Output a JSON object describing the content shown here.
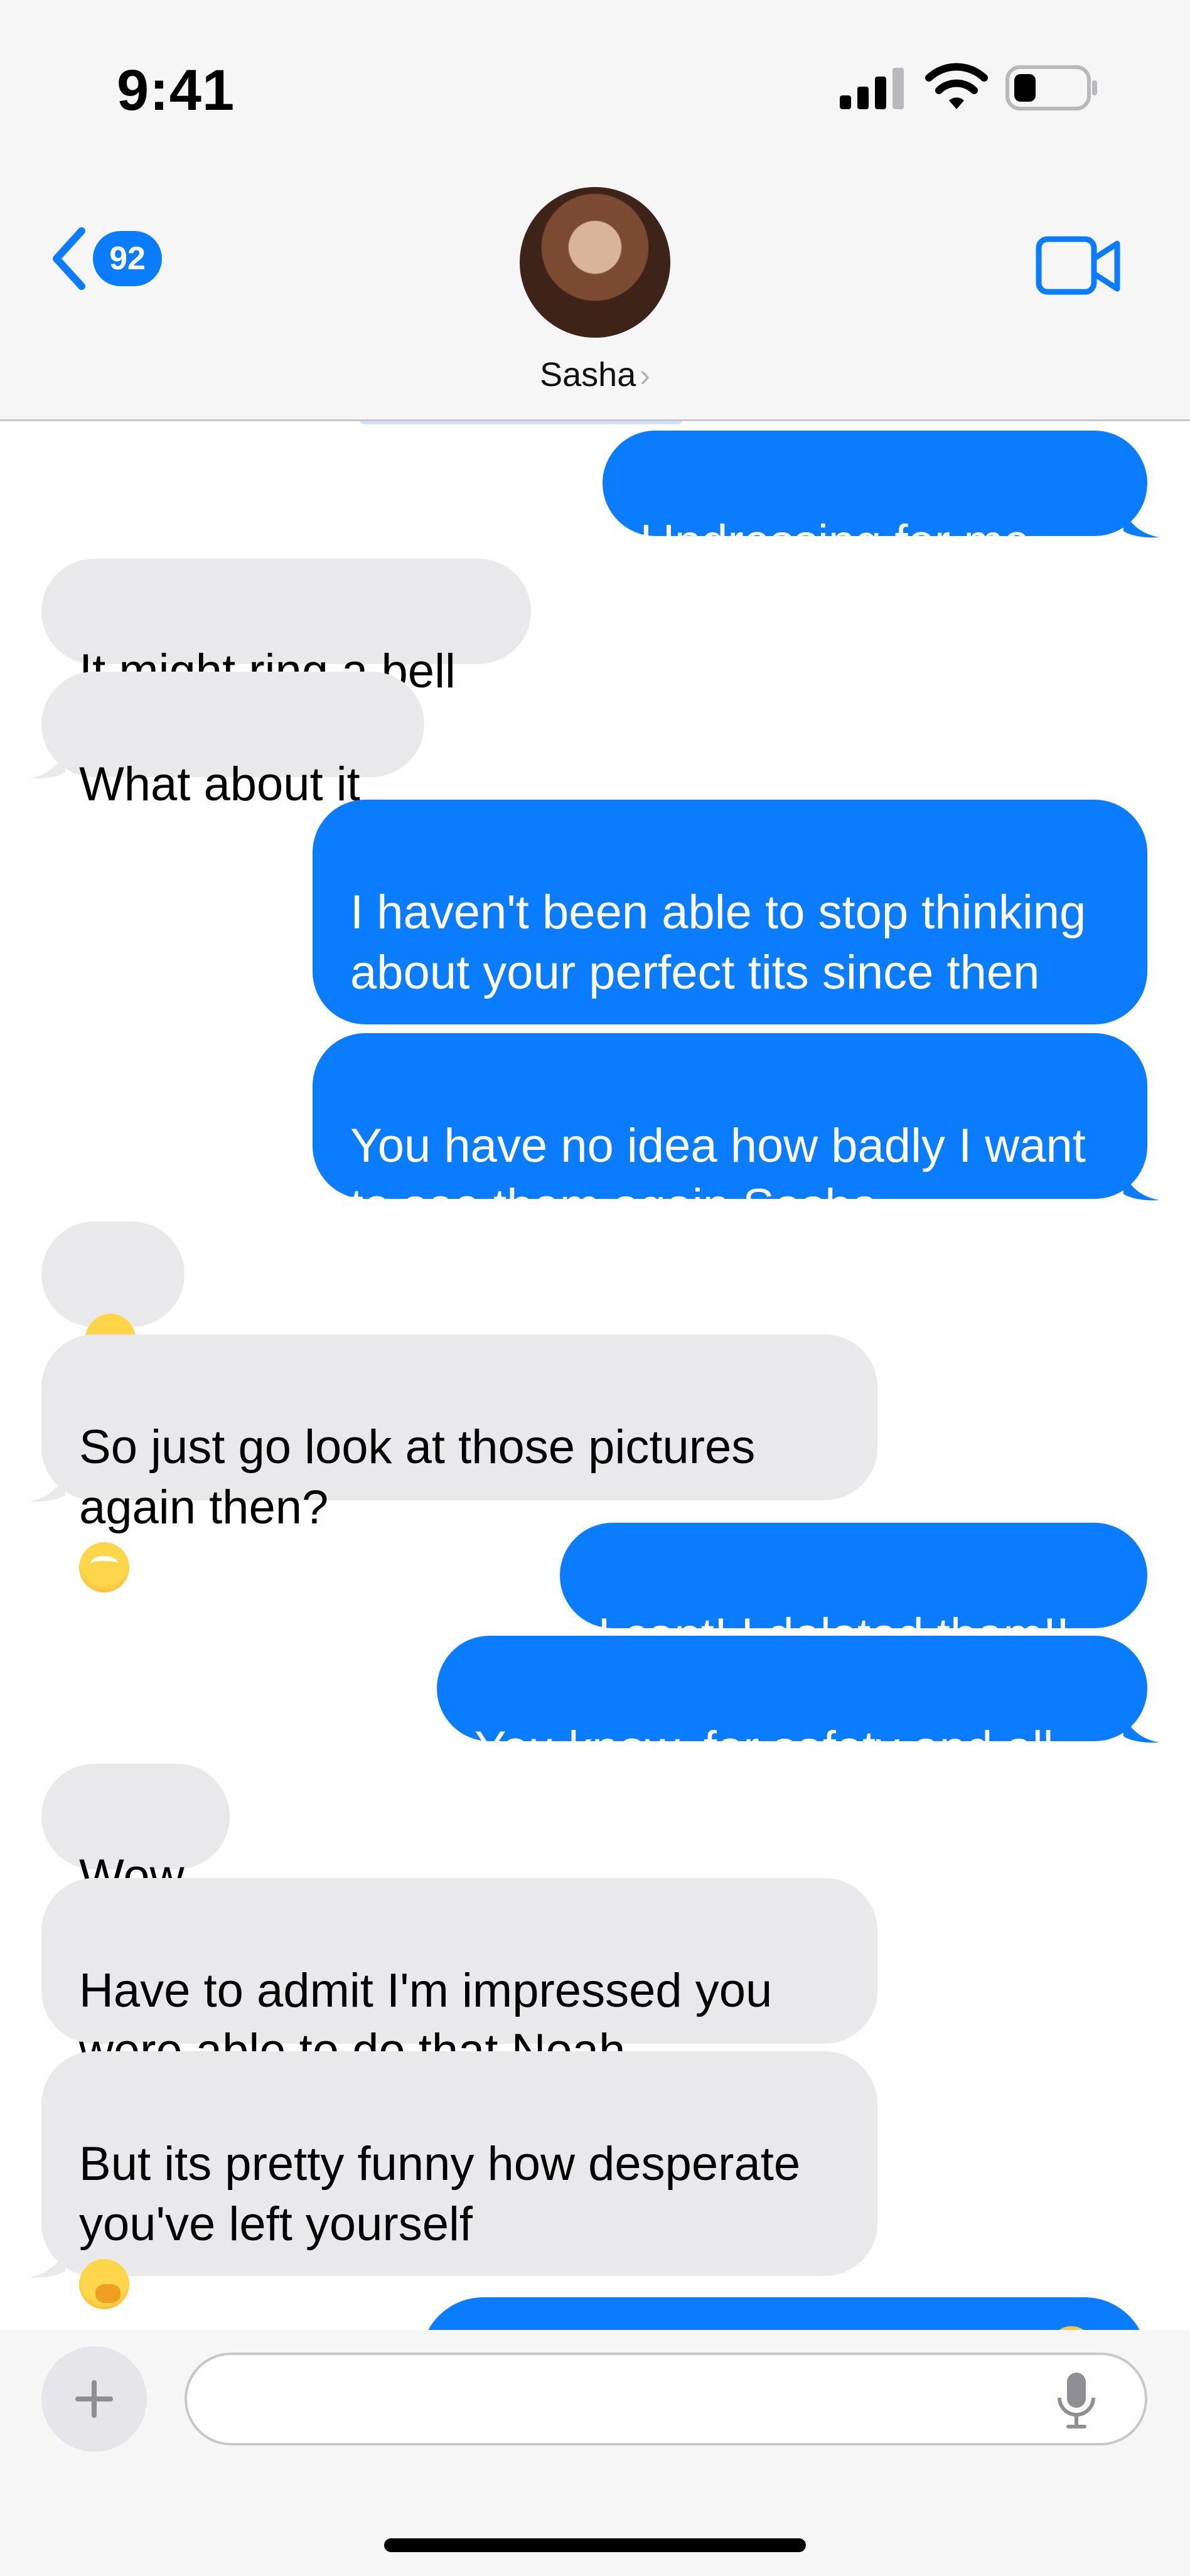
{
  "status_bar": {
    "time": "9:41"
  },
  "header": {
    "unread_count": "92",
    "contact_name": "Sasha",
    "contact_chevron": "›"
  },
  "colors": {
    "outgoing": "#0a7cff",
    "incoming": "#e9e9eb",
    "accent": "#0a7cff"
  },
  "messages": [
    {
      "dir": "out",
      "text": "Undressing for me..."
    },
    {
      "dir": "in",
      "text": "It might ring a bell"
    },
    {
      "dir": "in",
      "text": "What about it"
    },
    {
      "dir": "out",
      "text": "I haven't been able to stop thinking about your perfect tits since then"
    },
    {
      "dir": "out",
      "text": "You have no idea how badly I want to see them again Sasha"
    },
    {
      "dir": "in",
      "emoji": "face-with-tears-of-joy"
    },
    {
      "dir": "in",
      "text": "So just go look at those pictures again then?",
      "emoji": "face-with-rolling-eyes"
    },
    {
      "dir": "out",
      "text": "I cant! I deleted them!!"
    },
    {
      "dir": "out",
      "text": "You know, for safety and all"
    },
    {
      "dir": "in",
      "text": "Wow"
    },
    {
      "dir": "in",
      "text": "Have to admit I'm impressed you were able to do that Noah"
    },
    {
      "dir": "in",
      "text": "But its pretty funny how desperate you've left yourself",
      "emoji": "face-with-hand-over-mouth"
    }
  ],
  "icons": [
    "back-chevron-icon",
    "video-camera-icon",
    "plus-icon",
    "microphone-icon",
    "cellular-signal-icon",
    "wifi-icon",
    "battery-icon"
  ]
}
